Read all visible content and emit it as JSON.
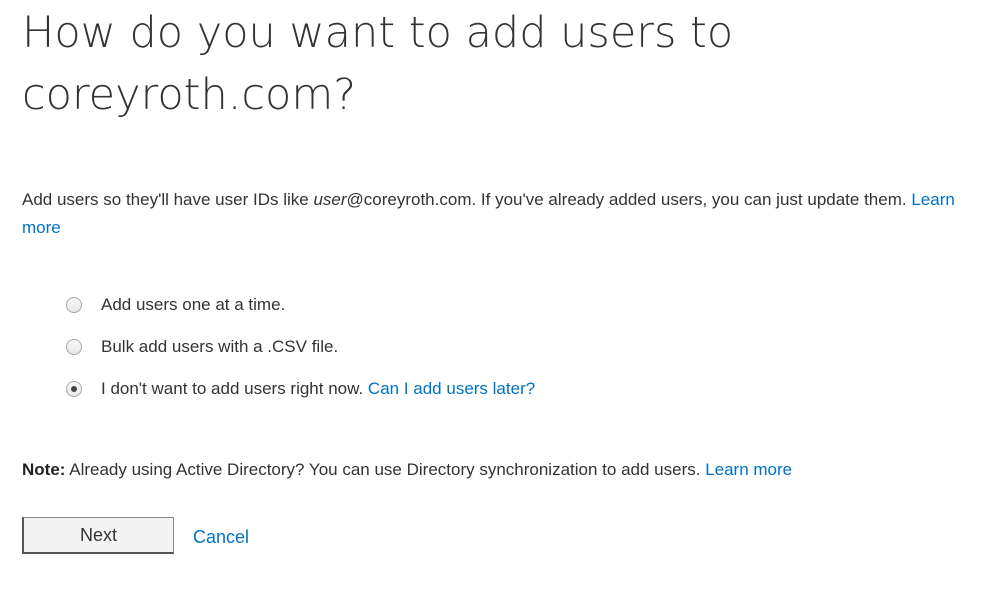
{
  "title": "How do you want to add users to coreyroth.com?",
  "intro": {
    "text_before": "Add users so they'll have user IDs like ",
    "example_user": "user",
    "text_after": "@coreyroth.com. If you've already added users, you can just update them. ",
    "learn_more": "Learn more"
  },
  "options": [
    {
      "label": "Add users one at a time.",
      "selected": false
    },
    {
      "label": "Bulk add users with a .CSV file.",
      "selected": false
    },
    {
      "label": "I don't want to add users right now.",
      "selected": true,
      "link": "Can I add users later?"
    }
  ],
  "note": {
    "label": "Note:",
    "text": " Already using Active Directory? You can use Directory synchronization to add users. ",
    "learn_more": "Learn more"
  },
  "buttons": {
    "next": "Next",
    "cancel": "Cancel"
  },
  "colors": {
    "link": "#0072c6",
    "text": "#333333"
  }
}
